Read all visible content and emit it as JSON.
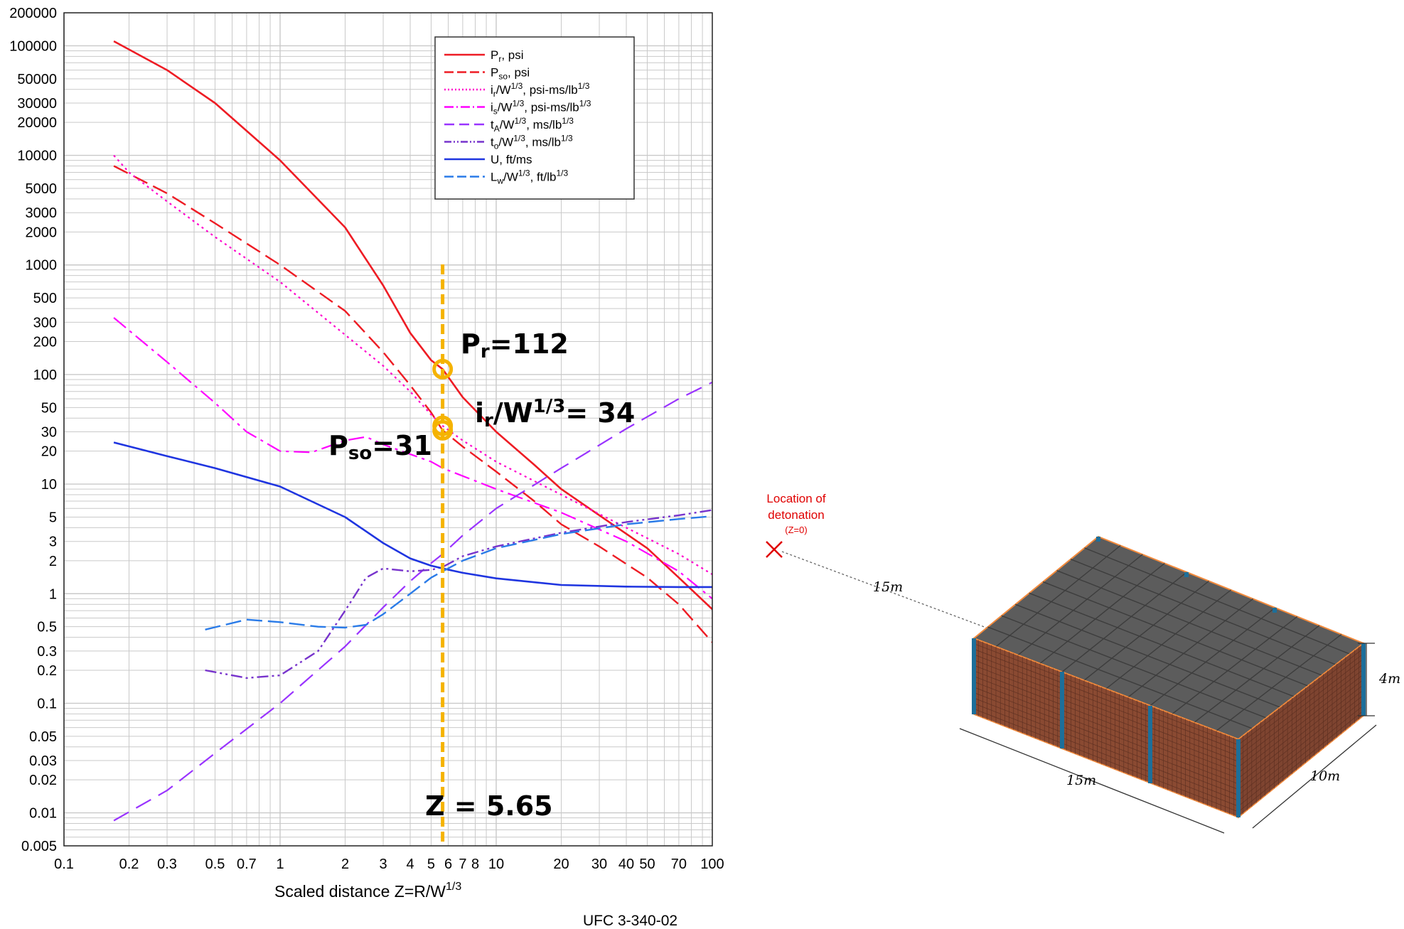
{
  "chart_data": {
    "type": "line",
    "x_scale": "log",
    "y_scale": "log",
    "xlim": [
      0.1,
      100
    ],
    "ylim": [
      0.005,
      200000
    ],
    "grid": true,
    "legend_position": "top-right",
    "xlabel": "Scaled distance Z=R/W",
    "xlabel_sup": "1/3",
    "source": "UFC 3-340-02",
    "x_ticks": [
      {
        "v": 0.1,
        "label": "0.1"
      },
      {
        "v": 0.2,
        "label": "0.2"
      },
      {
        "v": 0.3,
        "label": "0.3"
      },
      {
        "v": 0.5,
        "label": "0.5"
      },
      {
        "v": 0.7,
        "label": "0.7"
      },
      {
        "v": 1,
        "label": "1"
      },
      {
        "v": 2,
        "label": "2"
      },
      {
        "v": 3,
        "label": "3"
      },
      {
        "v": 4,
        "label": "4"
      },
      {
        "v": 5,
        "label": "5"
      },
      {
        "v": 6,
        "label": "6"
      },
      {
        "v": 7,
        "label": "7"
      },
      {
        "v": 8,
        "label": "8"
      },
      {
        "v": 10,
        "label": "10"
      },
      {
        "v": 20,
        "label": "20"
      },
      {
        "v": 30,
        "label": "30"
      },
      {
        "v": 40,
        "label": "40"
      },
      {
        "v": 50,
        "label": "50"
      },
      {
        "v": 70,
        "label": "70"
      },
      {
        "v": 100,
        "label": "100"
      }
    ],
    "y_ticks": [
      {
        "v": 200000,
        "label": "200000"
      },
      {
        "v": 100000,
        "label": "100000"
      },
      {
        "v": 50000,
        "label": "50000"
      },
      {
        "v": 30000,
        "label": "30000"
      },
      {
        "v": 20000,
        "label": "20000"
      },
      {
        "v": 10000,
        "label": "10000"
      },
      {
        "v": 5000,
        "label": "5000"
      },
      {
        "v": 3000,
        "label": "3000"
      },
      {
        "v": 2000,
        "label": "2000"
      },
      {
        "v": 1000,
        "label": "1000"
      },
      {
        "v": 500,
        "label": "500"
      },
      {
        "v": 300,
        "label": "300"
      },
      {
        "v": 200,
        "label": "200"
      },
      {
        "v": 100,
        "label": "100"
      },
      {
        "v": 50,
        "label": "50"
      },
      {
        "v": 30,
        "label": "30"
      },
      {
        "v": 20,
        "label": "20"
      },
      {
        "v": 10,
        "label": "10"
      },
      {
        "v": 5,
        "label": "5"
      },
      {
        "v": 3,
        "label": "3"
      },
      {
        "v": 2,
        "label": "2"
      },
      {
        "v": 1,
        "label": "1"
      },
      {
        "v": 0.5,
        "label": "0.5"
      },
      {
        "v": 0.3,
        "label": "0.3"
      },
      {
        "v": 0.2,
        "label": "0.2"
      },
      {
        "v": 0.1,
        "label": "0.1"
      },
      {
        "v": 0.05,
        "label": "0.05"
      },
      {
        "v": 0.03,
        "label": "0.03"
      },
      {
        "v": 0.02,
        "label": "0.02"
      },
      {
        "v": 0.01,
        "label": "0.01"
      },
      {
        "v": 0.005,
        "label": "0.005"
      }
    ],
    "series": [
      {
        "key": "pr",
        "color": "#ee1c24",
        "dash": "",
        "width": 2.6,
        "legend": {
          "base": "P",
          "sub": "r",
          "rest": ", psi",
          "parts": []
        },
        "points": [
          [
            0.17,
            110000
          ],
          [
            0.3,
            60000
          ],
          [
            0.5,
            30000
          ],
          [
            1,
            9000
          ],
          [
            2,
            2200
          ],
          [
            3,
            650
          ],
          [
            4,
            240
          ],
          [
            5,
            135
          ],
          [
            5.65,
            112
          ],
          [
            7,
            62
          ],
          [
            10,
            30
          ],
          [
            15,
            15
          ],
          [
            20,
            9
          ],
          [
            30,
            5.2
          ],
          [
            50,
            2.6
          ],
          [
            70,
            1.4
          ],
          [
            100,
            0.72
          ]
        ]
      },
      {
        "key": "pso",
        "color": "#ee1c24",
        "dash": "22,9",
        "width": 2.4,
        "legend": {
          "base": "P",
          "sub": "so",
          "rest": ", psi",
          "parts": []
        },
        "points": [
          [
            0.17,
            8000
          ],
          [
            0.3,
            4500
          ],
          [
            0.5,
            2400
          ],
          [
            1,
            1000
          ],
          [
            2,
            380
          ],
          [
            3,
            160
          ],
          [
            4,
            80
          ],
          [
            5,
            45
          ],
          [
            5.65,
            31
          ],
          [
            7,
            22
          ],
          [
            10,
            13
          ],
          [
            15,
            7
          ],
          [
            20,
            4.3
          ],
          [
            30,
            2.7
          ],
          [
            50,
            1.4
          ],
          [
            70,
            0.8
          ],
          [
            100,
            0.36
          ]
        ]
      },
      {
        "key": "ir",
        "color": "#ff00cc",
        "dash": "3,5",
        "width": 2.2,
        "legend": {
          "base": "",
          "sub": "",
          "rest": "",
          "parts": [
            [
              "i",
              ""
            ],
            [
              "r",
              "sub"
            ],
            [
              "/W",
              ""
            ],
            [
              "1/3",
              "sup"
            ],
            [
              ", psi-ms/lb",
              ""
            ],
            [
              "1/3",
              "sup"
            ]
          ]
        },
        "points": [
          [
            0.17,
            10000
          ],
          [
            0.2,
            7000
          ],
          [
            0.3,
            3800
          ],
          [
            0.5,
            1800
          ],
          [
            1,
            700
          ],
          [
            2,
            230
          ],
          [
            3,
            120
          ],
          [
            4,
            70
          ],
          [
            5,
            43
          ],
          [
            5.65,
            34
          ],
          [
            7,
            25
          ],
          [
            10,
            16
          ],
          [
            20,
            8
          ],
          [
            40,
            4
          ],
          [
            70,
            2.3
          ],
          [
            100,
            1.5
          ]
        ]
      },
      {
        "key": "is",
        "color": "#ff00ff",
        "dash": "22,7,4,7",
        "width": 2.2,
        "legend": {
          "base": "",
          "sub": "",
          "rest": "",
          "parts": [
            [
              "i",
              ""
            ],
            [
              "s",
              "sub"
            ],
            [
              "/W",
              ""
            ],
            [
              "1/3",
              "sup"
            ],
            [
              ", psi-ms/lb",
              ""
            ],
            [
              "1/3",
              "sup"
            ]
          ]
        },
        "points": [
          [
            0.17,
            330
          ],
          [
            0.3,
            130
          ],
          [
            0.5,
            55
          ],
          [
            0.7,
            30
          ],
          [
            1,
            20
          ],
          [
            1.4,
            19.5
          ],
          [
            2,
            25
          ],
          [
            2.5,
            27
          ],
          [
            3,
            23
          ],
          [
            5,
            16
          ],
          [
            5.65,
            14
          ],
          [
            10,
            9
          ],
          [
            20,
            5.5
          ],
          [
            40,
            3
          ],
          [
            70,
            1.6
          ],
          [
            100,
            0.9
          ]
        ]
      },
      {
        "key": "ta",
        "color": "#9933ff",
        "dash": "24,12",
        "width": 2.2,
        "legend": {
          "base": "",
          "sub": "",
          "rest": "",
          "parts": [
            [
              "t",
              ""
            ],
            [
              "A",
              "sub"
            ],
            [
              "/W",
              ""
            ],
            [
              "1/3",
              "sup"
            ],
            [
              ", ms/lb",
              ""
            ],
            [
              "1/3",
              "sup"
            ]
          ]
        },
        "points": [
          [
            0.17,
            0.0085
          ],
          [
            0.3,
            0.016
          ],
          [
            0.5,
            0.035
          ],
          [
            1,
            0.1
          ],
          [
            2,
            0.33
          ],
          [
            3,
            0.75
          ],
          [
            4,
            1.3
          ],
          [
            5,
            1.9
          ],
          [
            5.65,
            2.3
          ],
          [
            7,
            3.4
          ],
          [
            10,
            6
          ],
          [
            20,
            14
          ],
          [
            40,
            32
          ],
          [
            70,
            60
          ],
          [
            100,
            85
          ]
        ]
      },
      {
        "key": "to",
        "color": "#7733cc",
        "dash": "16,5,3,5,3,5",
        "width": 2.4,
        "legend": {
          "base": "",
          "sub": "",
          "rest": "",
          "parts": [
            [
              "t",
              ""
            ],
            [
              "o",
              "sub"
            ],
            [
              "/W",
              ""
            ],
            [
              "1/3",
              "sup"
            ],
            [
              ", ms/lb",
              ""
            ],
            [
              "1/3",
              "sup"
            ]
          ]
        },
        "points": [
          [
            0.45,
            0.2
          ],
          [
            0.7,
            0.17
          ],
          [
            1,
            0.18
          ],
          [
            1.5,
            0.3
          ],
          [
            2,
            0.7
          ],
          [
            2.5,
            1.4
          ],
          [
            3,
            1.7
          ],
          [
            4,
            1.6
          ],
          [
            5,
            1.65
          ],
          [
            5.65,
            1.75
          ],
          [
            7,
            2.2
          ],
          [
            10,
            2.7
          ],
          [
            20,
            3.6
          ],
          [
            40,
            4.5
          ],
          [
            70,
            5.2
          ],
          [
            100,
            5.8
          ]
        ]
      },
      {
        "key": "u",
        "color": "#1f35e0",
        "dash": "",
        "width": 2.6,
        "legend": {
          "base": "U, ft/ms",
          "sub": "",
          "rest": "",
          "parts": []
        },
        "points": [
          [
            0.17,
            24
          ],
          [
            0.3,
            18
          ],
          [
            0.5,
            14
          ],
          [
            1,
            9.5
          ],
          [
            2,
            5
          ],
          [
            3,
            2.9
          ],
          [
            4,
            2.1
          ],
          [
            5,
            1.8
          ],
          [
            5.65,
            1.7
          ],
          [
            7,
            1.55
          ],
          [
            10,
            1.38
          ],
          [
            20,
            1.2
          ],
          [
            40,
            1.16
          ],
          [
            70,
            1.15
          ],
          [
            100,
            1.15
          ]
        ]
      },
      {
        "key": "lw",
        "color": "#2a7be8",
        "dash": "22,8",
        "width": 2.4,
        "legend": {
          "base": "",
          "sub": "",
          "rest": "",
          "parts": [
            [
              "L",
              ""
            ],
            [
              "w",
              "sub"
            ],
            [
              "/W",
              ""
            ],
            [
              "1/3",
              "sup"
            ],
            [
              ", ft/lb",
              ""
            ],
            [
              "1/3",
              "sup"
            ]
          ]
        },
        "points": [
          [
            0.45,
            0.47
          ],
          [
            0.7,
            0.58
          ],
          [
            1,
            0.55
          ],
          [
            1.5,
            0.5
          ],
          [
            2,
            0.49
          ],
          [
            2.5,
            0.52
          ],
          [
            3,
            0.65
          ],
          [
            4,
            1.0
          ],
          [
            5,
            1.4
          ],
          [
            5.65,
            1.6
          ],
          [
            7,
            2
          ],
          [
            10,
            2.6
          ],
          [
            20,
            3.5
          ],
          [
            40,
            4.3
          ],
          [
            70,
            4.8
          ],
          [
            100,
            5.1
          ]
        ]
      }
    ],
    "marker_x": 5.65,
    "markers": [
      {
        "key": "pr",
        "y": 112
      },
      {
        "key": "ir",
        "y": 34
      },
      {
        "key": "pso",
        "y": 31
      }
    ],
    "annotations": {
      "pr": {
        "base": "P",
        "sub": "r",
        "rest": "=112"
      },
      "ir": {
        "base": "i",
        "sub": "r",
        "mid": "/W",
        "sup": "1/3",
        "rest": "= 34"
      },
      "pso": {
        "base": "P",
        "sub": "so",
        "rest": "=31"
      },
      "z": "Z = 5.65"
    },
    "colors": {
      "marker": "#f5b300",
      "grid": "#c9c9c9"
    }
  },
  "diagram": {
    "detonation_label_line1": "Location of",
    "detonation_label_line2": "detonation",
    "detonation_label_line3": "(Z=0)",
    "distance_label": "15m",
    "length_label": "15m",
    "width_label": "10m",
    "height_label": "4m",
    "colors": {
      "detonation": "#e00000",
      "roof": "#5c5c5c",
      "wall": "#8a4a32",
      "column": "#1d6f9a",
      "edge": "#f28a3c"
    }
  }
}
